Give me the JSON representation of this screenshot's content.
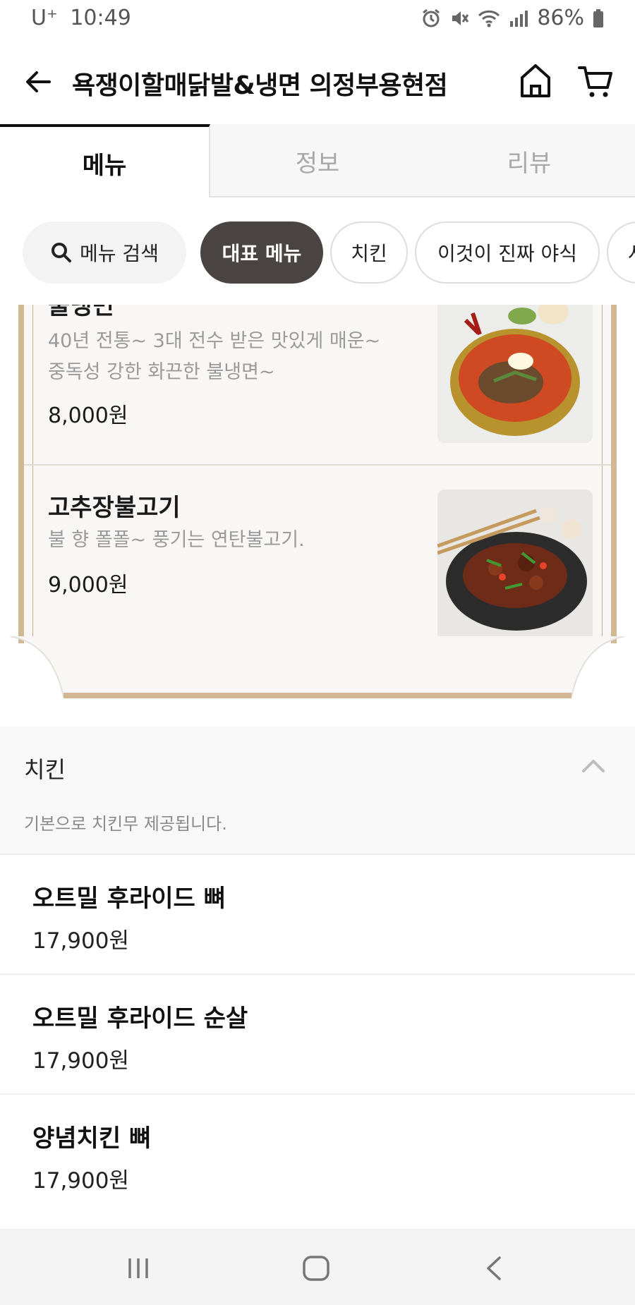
{
  "status_bar": {
    "carrier": "U⁺",
    "time": "10:49",
    "battery": "86%"
  },
  "header": {
    "title": "욕쟁이할매닭발&냉면 의정부용현점"
  },
  "tabs": [
    {
      "label": "메뉴",
      "active": true
    },
    {
      "label": "정보",
      "active": false
    },
    {
      "label": "리뷰",
      "active": false
    }
  ],
  "chips": {
    "search_label": "메뉴 검색",
    "items": [
      {
        "label": "대표 메뉴",
        "active": true
      },
      {
        "label": "치킨",
        "active": false
      },
      {
        "label": "이것이 진짜 야식",
        "active": false
      },
      {
        "label": "사",
        "active": false
      }
    ]
  },
  "featured": {
    "items": [
      {
        "name": "물냉면",
        "description_lines": [
          "40년 전통~ 3대 전수 받은 맛있게 매운~",
          "중독성 강한 화끈한 불냉면~"
        ],
        "price": "8,000원",
        "image": "spicy-cold-noodles-photo"
      },
      {
        "name": "고추장불고기",
        "description_lines": [
          "불 향 폴폴~ 풍기는 연탄불고기."
        ],
        "price": "9,000원",
        "image": "gochujang-bulgogi-photo"
      }
    ]
  },
  "section": {
    "name": "치킨",
    "description": "기본으로 치킨무 제공됩니다.",
    "expanded": true
  },
  "menu_items": [
    {
      "name": "오트밀 후라이드 뼈",
      "price": "17,900원"
    },
    {
      "name": "오트밀 후라이드 순살",
      "price": "17,900원"
    },
    {
      "name": "양념치킨 뼈",
      "price": "17,900원"
    }
  ],
  "colors": {
    "accent_chip": "#4a4543",
    "frame_gold": "#d1b793",
    "muted_text": "#9a9a9a"
  }
}
